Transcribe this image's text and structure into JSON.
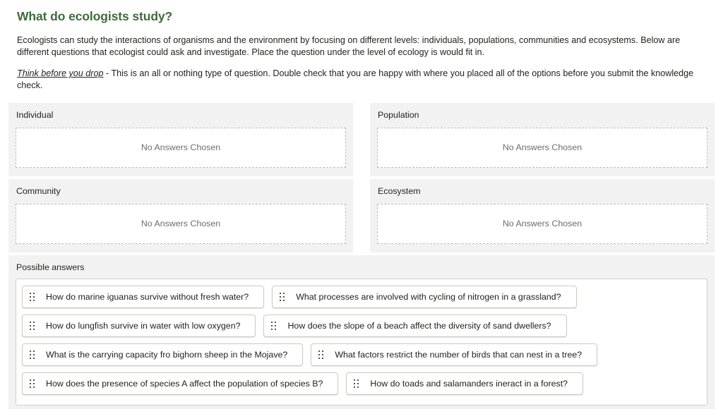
{
  "page": {
    "title": "What do ecologists study?",
    "title_color": "#3e6b3d",
    "intro_paragraph": "Ecologists can study the interactions of organisms and the environment by focusing on different levels: individuals, populations, communities and ecosystems. Below are different questions that ecologist could ask and investigate. Place the question under the level of ecology is would fit in.",
    "warning_emphasis": "Think before you drop",
    "warning_rest": " - This is an all or nothing type of question. Double check that you are happy with where you placed all of the options before you submit the knowledge check."
  },
  "drop_zones": [
    {
      "label": "Individual",
      "placeholder": "No Answers Chosen"
    },
    {
      "label": "Population",
      "placeholder": "No Answers Chosen"
    },
    {
      "label": "Community",
      "placeholder": "No Answers Chosen"
    },
    {
      "label": "Ecosystem",
      "placeholder": "No Answers Chosen"
    }
  ],
  "possible_answers": {
    "label": "Possible answers",
    "handle_icon": "drag-handle-icon",
    "items": [
      {
        "text": "How do marine iguanas survive without fresh water?"
      },
      {
        "text": "What processes are involved with cycling of nitrogen in a grassland?"
      },
      {
        "text": "How do lungfish survive in water with low oxygen?"
      },
      {
        "text": "How does the slope of a beach affect the diversity of sand dwellers?"
      },
      {
        "text": "What is the carrying capacity fro bighorn sheep in the Mojave?"
      },
      {
        "text": "What factors restrict the number of birds that can nest in a tree?"
      },
      {
        "text": "How does the presence of species A affect the population of species B?"
      },
      {
        "text": "How do toads and salamanders ineract in a forest?"
      }
    ]
  },
  "colors": {
    "panel_background": "#f2f2f2",
    "page_background": "#ffffff",
    "text": "#22221f",
    "muted_text": "#6d6d6d",
    "accent_green": "#3e6b3d",
    "dashed_border": "#bdbdbd"
  }
}
